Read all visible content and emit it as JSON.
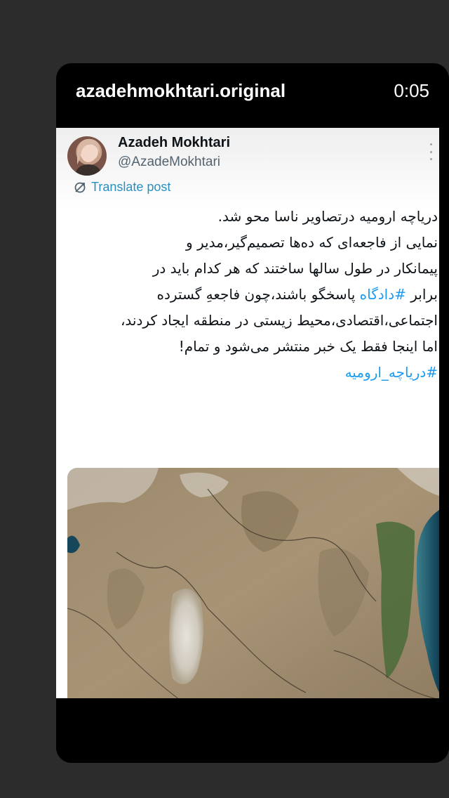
{
  "story": {
    "username": "azadehmokhtari.original",
    "time": "0:05"
  },
  "post": {
    "display_name": "Azadeh Mokhtari",
    "handle": "@AzadeMokhtari",
    "translate_label": "Translate post",
    "line1": "دریاچه ارومیه درتصاویر ناسا محو شد.",
    "line2": "نمایی از فاجعه‌ای که ده‌ها  تصمیم‌گیر،مدیر و",
    "line3": "پیمانکار در طول سالها ساختند که هر کدام باید در",
    "line4_before": "برابر ",
    "line4_tag": "#دادگاه",
    "line4_after": " پاسخگو باشند،چون فاجعهِ گسترده",
    "line5": "اجتماعی،اقتصادی،محیط زیستی در منطقه ایجاد کردند،",
    "line6": "اما اینجا فقط یک خبر منتشر می‌شود و تمام!",
    "hashtag": "#دریاچه_ارومیه"
  },
  "icons": {
    "more": "more-vertical-icon",
    "translate": "translate-icon"
  },
  "colors": {
    "link": "#1d9bf0",
    "background": "#2c2c2c",
    "story_bg": "#000000"
  }
}
